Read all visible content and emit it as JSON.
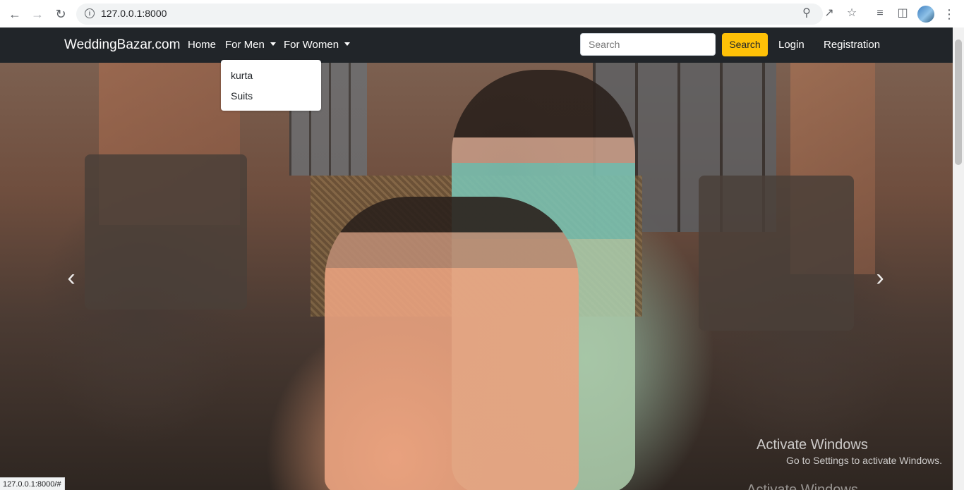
{
  "browser": {
    "url": "127.0.0.1:8000",
    "status_url": "127.0.0.1:8000/#"
  },
  "navbar": {
    "brand": "WeddingBazar.com",
    "links": {
      "home": "Home",
      "men": "For Men",
      "women": "For Women",
      "login": "Login",
      "registration": "Registration"
    },
    "search": {
      "placeholder": "Search",
      "button": "Search"
    }
  },
  "dropdown_men": {
    "items": [
      "kurta",
      "Suits"
    ]
  },
  "carousel": {
    "prev": "‹",
    "next": "›"
  },
  "watermark": {
    "line1": "Activate Windows",
    "line2": "Go to Settings to activate Windows.",
    "line3": "Activate Windows"
  },
  "colors": {
    "navbar_bg": "#212529",
    "search_button": "#ffc107"
  }
}
